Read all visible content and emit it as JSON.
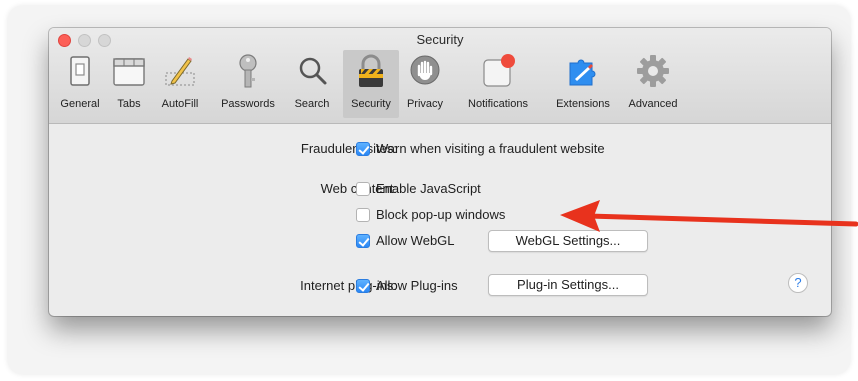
{
  "window": {
    "title": "Security"
  },
  "toolbar": {
    "tabs": [
      {
        "label": "General",
        "icon": "general-switch-icon"
      },
      {
        "label": "Tabs",
        "icon": "tabs-window-icon"
      },
      {
        "label": "AutoFill",
        "icon": "autofill-pencil-icon"
      },
      {
        "label": "Passwords",
        "icon": "key-icon"
      },
      {
        "label": "Search",
        "icon": "magnifier-icon"
      },
      {
        "label": "Security",
        "icon": "padlock-icon",
        "selected": true
      },
      {
        "label": "Privacy",
        "icon": "privacy-hand-icon"
      },
      {
        "label": "Notifications",
        "icon": "notifications-badge-icon"
      },
      {
        "label": "Extensions",
        "icon": "extensions-puzzle-icon"
      },
      {
        "label": "Advanced",
        "icon": "advanced-gear-icon"
      }
    ]
  },
  "security": {
    "fraudulent": {
      "label": "Fraudulent sites:",
      "warn": {
        "text": "Warn when visiting a fraudulent website",
        "checked": true
      }
    },
    "web_content": {
      "label": "Web content:",
      "javascript": {
        "text": "Enable JavaScript",
        "checked": false
      },
      "popups": {
        "text": "Block pop-up windows",
        "checked": false
      },
      "webgl": {
        "text": "Allow WebGL",
        "checked": true
      },
      "webgl_settings": "WebGL Settings..."
    },
    "plugins": {
      "label": "Internet plug-ins:",
      "allow": {
        "text": "Allow Plug-ins",
        "checked": true
      },
      "settings": "Plug-in Settings..."
    },
    "help": "?"
  },
  "colors": {
    "accent": "#2a87f5",
    "annotation_arrow": "#e8321d",
    "close_button": "#fc5f57"
  }
}
